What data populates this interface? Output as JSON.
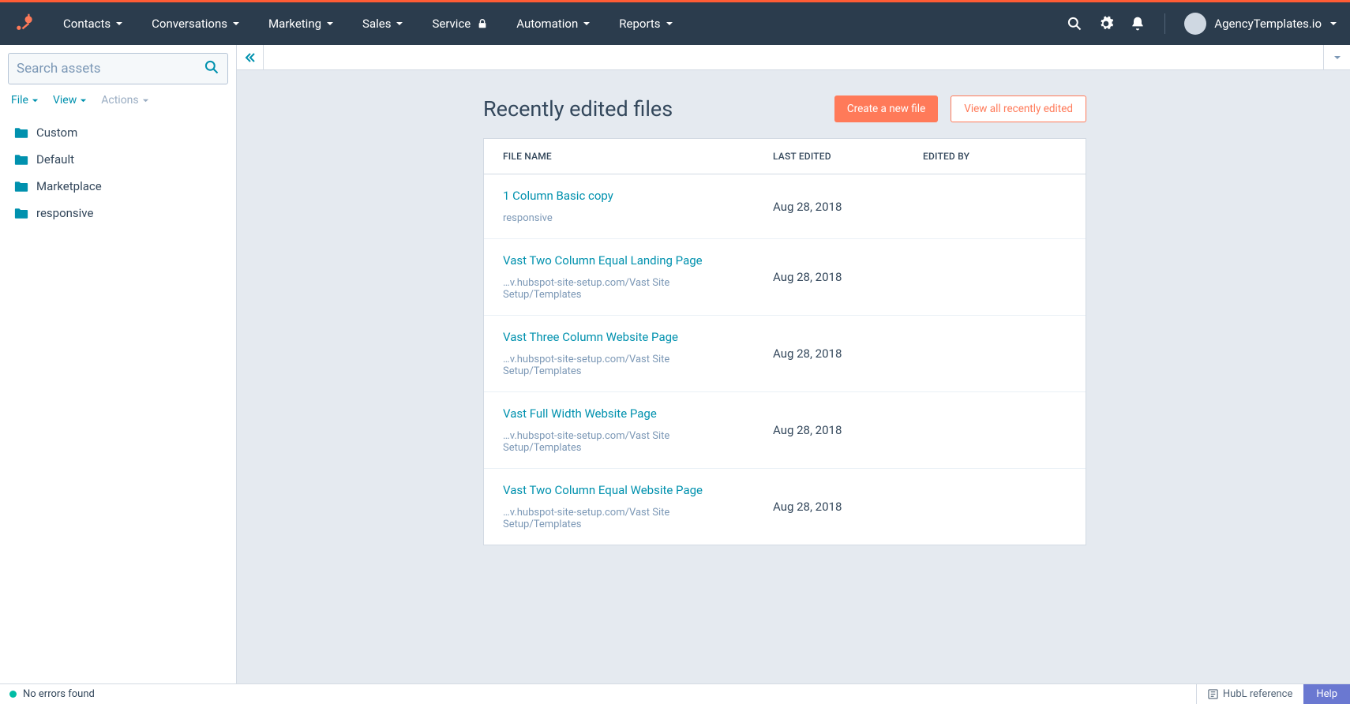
{
  "nav": {
    "items": [
      "Contacts",
      "Conversations",
      "Marketing",
      "Sales",
      "Service",
      "Automation",
      "Reports"
    ],
    "account_label": "AgencyTemplates.io"
  },
  "sidebar": {
    "search_placeholder": "Search assets",
    "actions": {
      "file": "File",
      "view": "View",
      "actions": "Actions"
    },
    "folders": [
      "Custom",
      "Default",
      "Marketplace",
      "responsive"
    ]
  },
  "main": {
    "title": "Recently edited files",
    "btn_create": "Create a new file",
    "btn_view_all": "View all recently edited",
    "columns": {
      "file_name": "FILE NAME",
      "last_edited": "LAST EDITED",
      "edited_by": "EDITED BY"
    },
    "rows": [
      {
        "name": "1 Column Basic copy",
        "path": "responsive",
        "last_edited": "Aug 28, 2018"
      },
      {
        "name": "Vast Two Column Equal Landing Page",
        "path": "…v.hubspot-site-setup.com/Vast Site Setup/Templates",
        "last_edited": "Aug 28, 2018"
      },
      {
        "name": "Vast Three Column Website Page",
        "path": "…v.hubspot-site-setup.com/Vast Site Setup/Templates",
        "last_edited": "Aug 28, 2018"
      },
      {
        "name": "Vast Full Width Website Page",
        "path": "…v.hubspot-site-setup.com/Vast Site Setup/Templates",
        "last_edited": "Aug 28, 2018"
      },
      {
        "name": "Vast Two Column Equal Website Page",
        "path": "…v.hubspot-site-setup.com/Vast Site Setup/Templates",
        "last_edited": "Aug 28, 2018"
      }
    ]
  },
  "statusbar": {
    "no_errors": "No errors found",
    "hubl": "HubL reference",
    "help": "Help"
  }
}
